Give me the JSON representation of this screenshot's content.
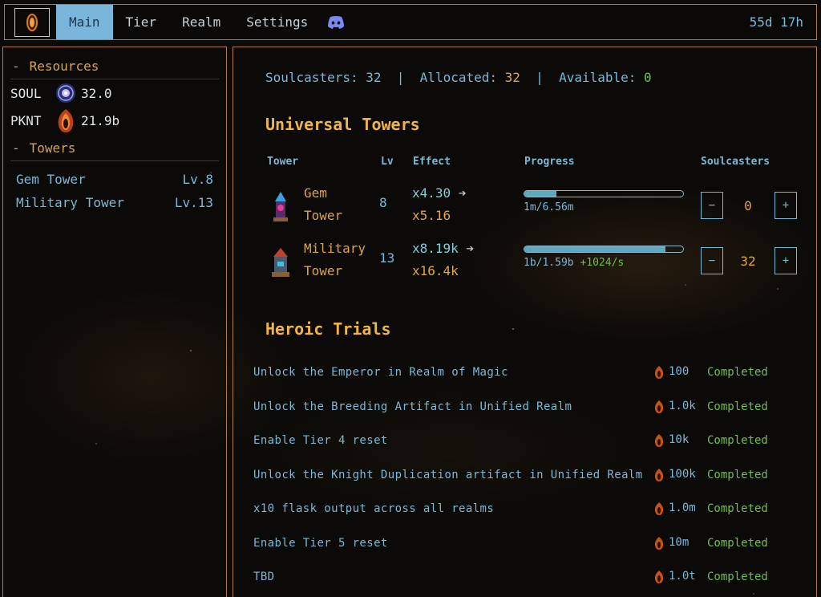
{
  "nav": {
    "items": [
      "Main",
      "Tier",
      "Realm",
      "Settings"
    ],
    "active": "Main",
    "timer": "55d 17h"
  },
  "sidebar": {
    "resources_heading": "Resources",
    "resources": [
      {
        "label": "SOUL",
        "value": "32.0",
        "icon": "soul-orb-icon"
      },
      {
        "label": "PKNT",
        "value": "21.9b",
        "icon": "pknt-flame-icon"
      }
    ],
    "towers_heading": "Towers",
    "towers": [
      {
        "name": "Gem Tower",
        "level": "Lv.8"
      },
      {
        "name": "Military Tower",
        "level": "Lv.13"
      }
    ]
  },
  "summary": {
    "soulcasters_label": "Soulcasters:",
    "soulcasters": "32",
    "allocated_label": "Allocated:",
    "allocated": "32",
    "available_label": "Available:",
    "available": "0"
  },
  "universal": {
    "title": "Universal Towers",
    "headers": {
      "tower": "Tower",
      "lv": "Lv",
      "effect": "Effect",
      "progress": "Progress",
      "soulcasters": "Soulcasters"
    },
    "rows": [
      {
        "name_line1": "Gem",
        "name_line2": "Tower",
        "lv": "8",
        "effect_cur": "x4.30",
        "effect_next": "x5.16",
        "progress_text": "1m/6.56m",
        "rate": "",
        "progress_fraction": 0.2,
        "soulcasters": "0"
      },
      {
        "name_line1": "Military",
        "name_line2": "Tower",
        "lv": "13",
        "effect_cur": "x8.19k",
        "effect_next": "x16.4k",
        "progress_text": "1b/1.59b",
        "rate": "+1024/s",
        "progress_fraction": 0.89,
        "soulcasters": "32"
      }
    ]
  },
  "trials": {
    "title": "Heroic Trials",
    "items": [
      {
        "name": "Unlock the Emperor in Realm of Magic",
        "cost": "100",
        "status": "Completed"
      },
      {
        "name": "Unlock the Breeding Artifact in Unified Realm",
        "cost": "1.0k",
        "status": "Completed"
      },
      {
        "name": "Enable Tier 4 reset",
        "cost": "10k",
        "status": "Completed"
      },
      {
        "name": "Unlock the Knight Duplication artifact in Unified Realm",
        "cost": "100k",
        "status": "Completed"
      },
      {
        "name": "x10 flask output across all realms",
        "cost": "1.0m",
        "status": "Completed"
      },
      {
        "name": "Enable Tier 5 reset",
        "cost": "10m",
        "status": "Completed"
      },
      {
        "name": "TBD",
        "cost": "1.0t",
        "status": "Completed"
      }
    ]
  },
  "colors": {
    "accent": "#7ab6dc",
    "gold": "#e0a644",
    "green": "#6fbf4a",
    "border": "#b07a50"
  }
}
